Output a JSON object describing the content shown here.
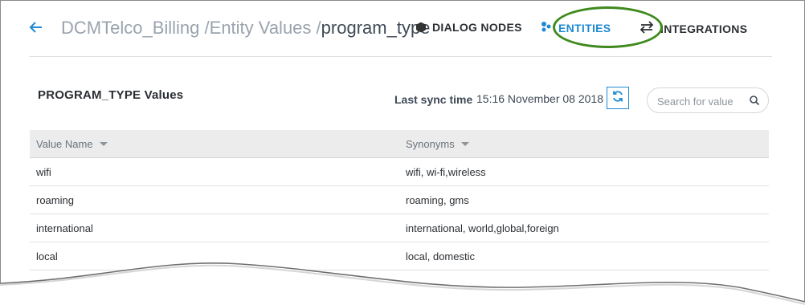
{
  "header": {
    "breadcrumbs": [
      "DCMTelco_Billing",
      "Entity Values",
      "program_type"
    ],
    "nav": [
      {
        "label": "DIALOG NODES",
        "icon": "hexagon-icon"
      },
      {
        "label": "ENTITIES",
        "icon": "entities-dots-icon",
        "active": true
      },
      {
        "label": "INTEGRATIONS",
        "icon": "swap-arrows-icon"
      }
    ]
  },
  "card": {
    "title": "PROGRAM_TYPE Values",
    "sync_label": "Last sync time",
    "sync_time": "15:16 November 08 2018",
    "search_placeholder": "Search for value"
  },
  "table": {
    "columns": [
      "Value Name",
      "Synonyms"
    ],
    "rows": [
      [
        "wifi",
        "wifi, wi-fi,wireless"
      ],
      [
        "roaming",
        "roaming, gms"
      ],
      [
        "international",
        "international, world,global,foreign"
      ],
      [
        "local",
        "local, domestic"
      ]
    ]
  },
  "colors": {
    "accent": "#1f8ad1",
    "highlight_ellipse": "#3f8a1e"
  }
}
